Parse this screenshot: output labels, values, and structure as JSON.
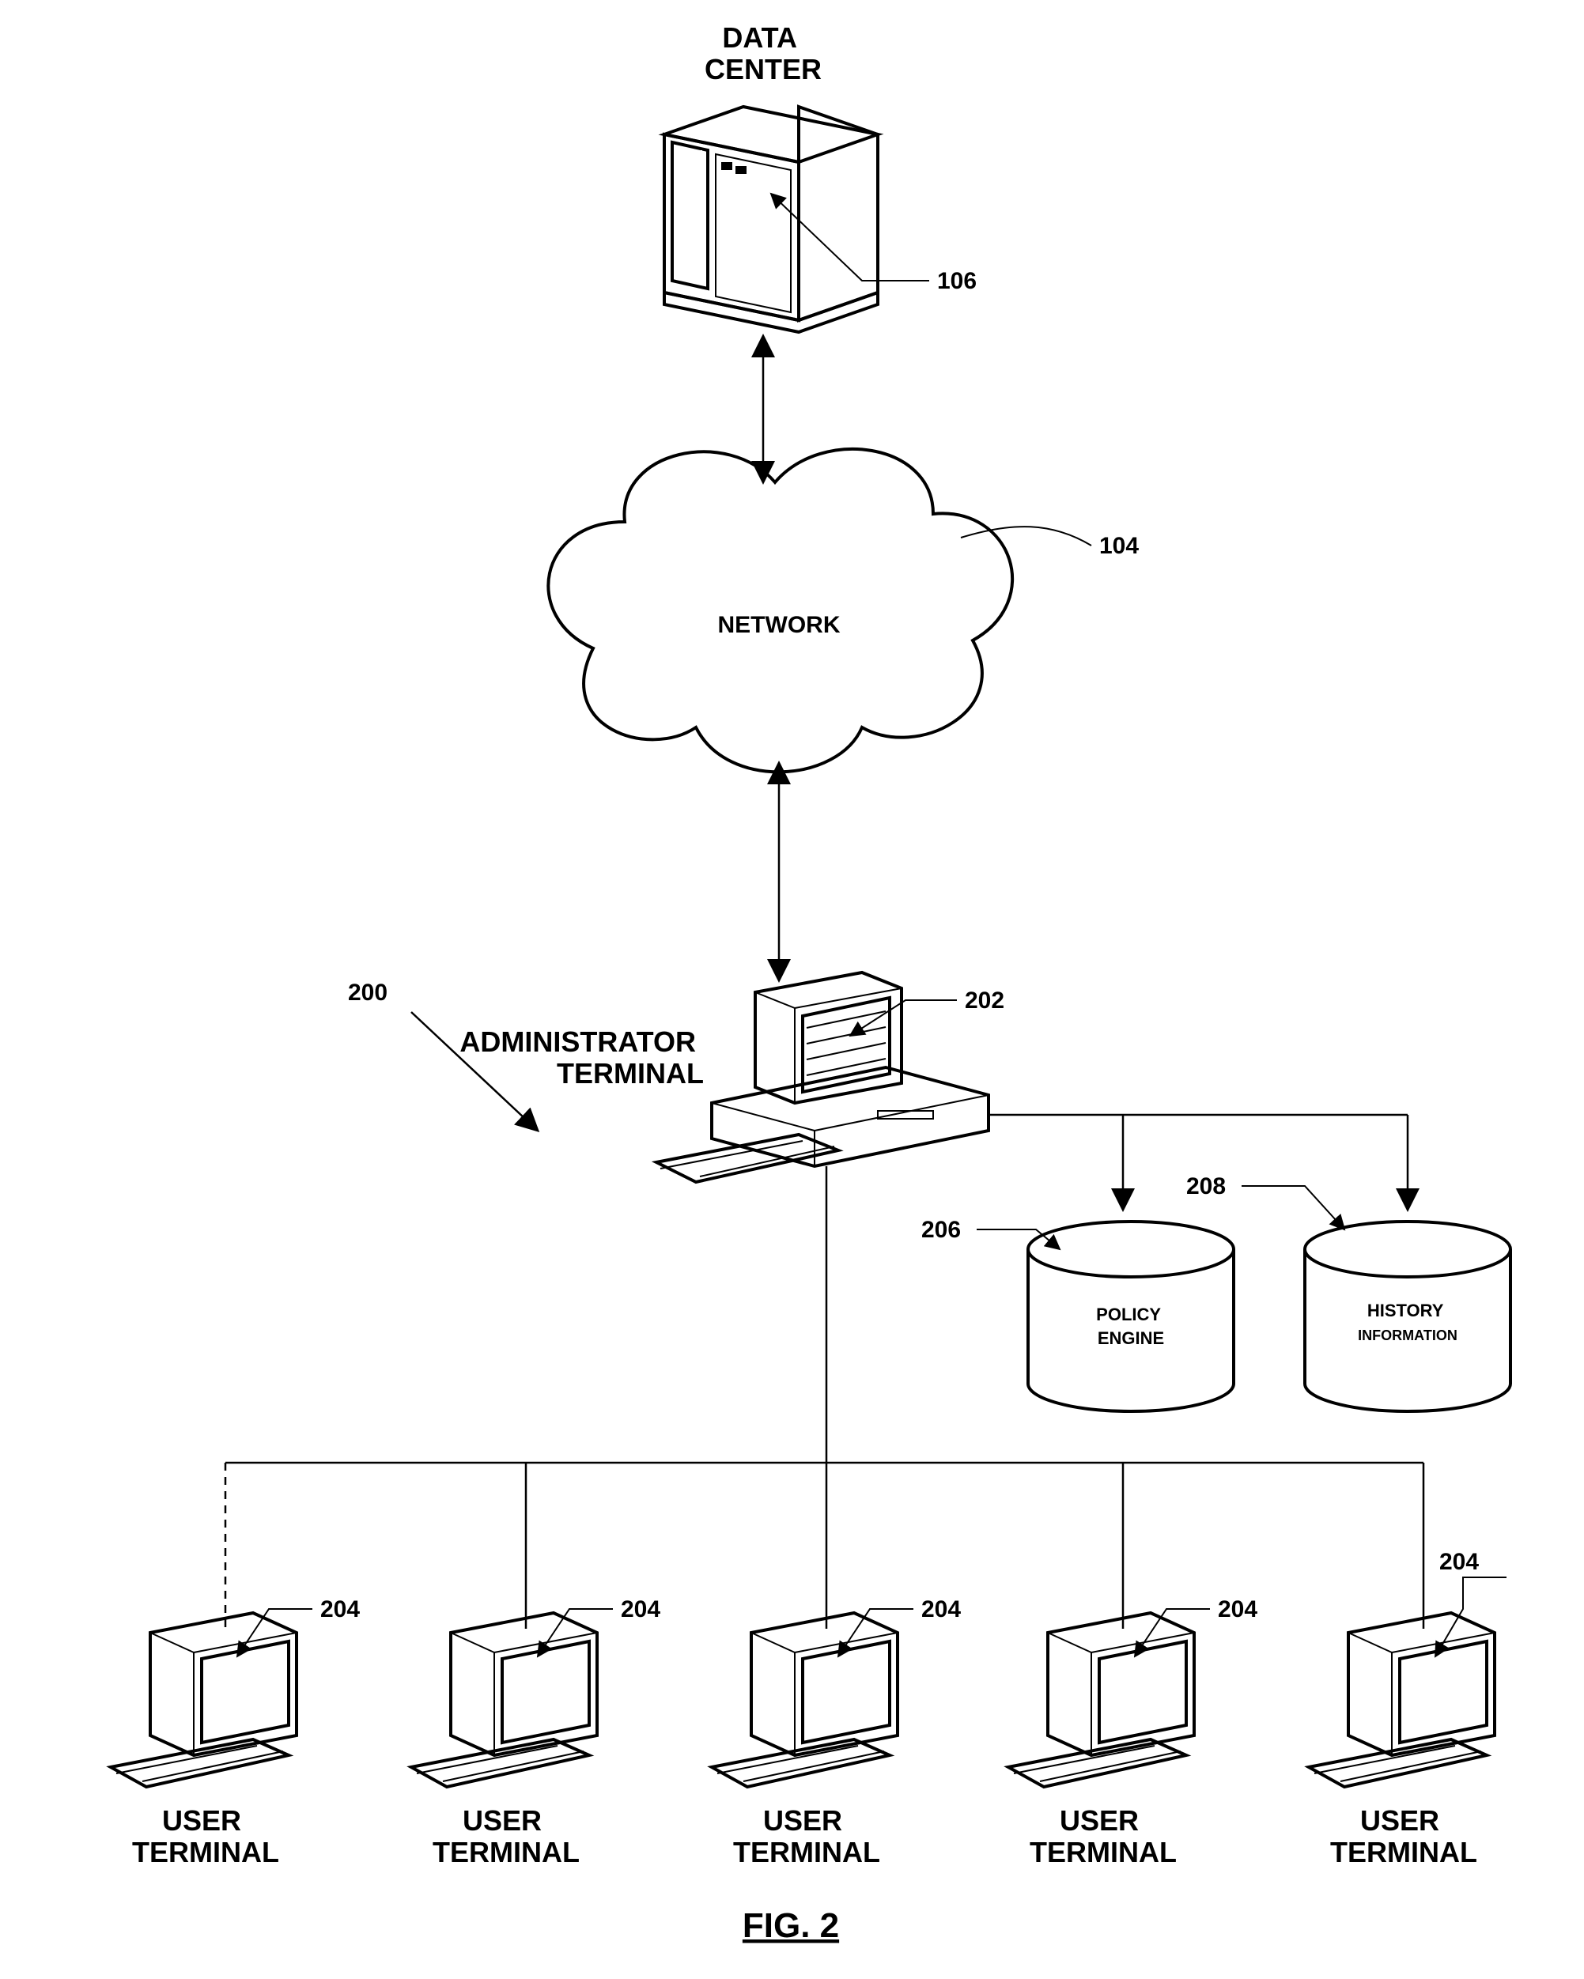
{
  "title": {
    "line1": "DATA",
    "line2": "CENTER"
  },
  "network": {
    "label": "NETWORK"
  },
  "admin": {
    "line1": "ADMINISTRATOR",
    "line2": "TERMINAL"
  },
  "cylinders": {
    "policy": {
      "line1": "POLICY",
      "line2": "ENGINE"
    },
    "history": {
      "line1": "HISTORY",
      "line2": "INFORMATION"
    }
  },
  "user_terminals": [
    {
      "line1": "USER",
      "line2": "TERMINAL"
    },
    {
      "line1": "USER",
      "line2": "TERMINAL"
    },
    {
      "line1": "USER",
      "line2": "TERMINAL"
    },
    {
      "line1": "USER",
      "line2": "TERMINAL"
    },
    {
      "line1": "USER",
      "line2": "TERMINAL"
    }
  ],
  "refs": {
    "r104": "104",
    "r106": "106",
    "r200": "200",
    "r202": "202",
    "r204a": "204",
    "r204b": "204",
    "r204c": "204",
    "r204d": "204",
    "r204e": "204",
    "r206": "206",
    "r208": "208"
  },
  "figure_caption": "FIG. 2"
}
